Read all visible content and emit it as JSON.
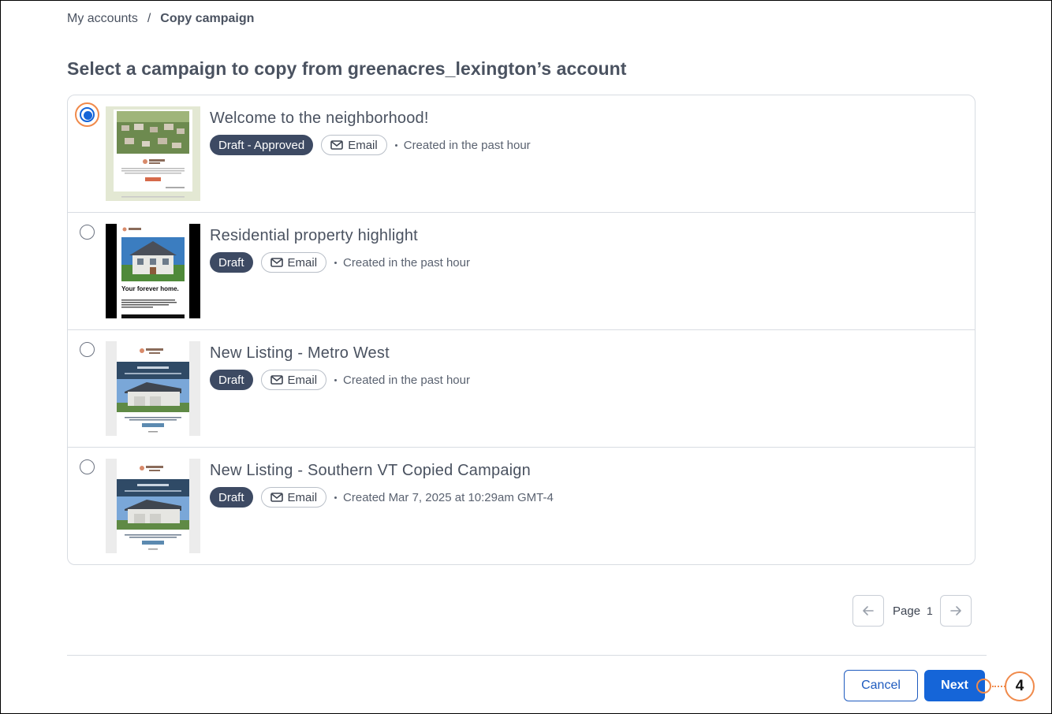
{
  "breadcrumb": {
    "root": "My accounts",
    "separator": "/",
    "current": "Copy campaign"
  },
  "page_title": "Select a campaign to copy from greenacres_lexington’s account",
  "campaigns": [
    {
      "title": "Welcome to the neighborhood!",
      "status": "Draft - Approved",
      "type": "Email",
      "created": "Created in the past hour",
      "selected": true
    },
    {
      "title": "Residential property highlight",
      "status": "Draft",
      "type": "Email",
      "created": "Created in the past hour",
      "selected": false
    },
    {
      "title": "New Listing - Metro West",
      "status": "Draft",
      "type": "Email",
      "created": "Created in the past hour",
      "selected": false
    },
    {
      "title": "New Listing - Southern VT Copied Campaign",
      "status": "Draft",
      "type": "Email",
      "created": "Created Mar 7, 2025 at 10:29am GMT-4",
      "selected": false
    }
  ],
  "thumbnails": {
    "residential_headline": "Your forever home."
  },
  "pagination": {
    "label": "Page",
    "current": "1"
  },
  "footer": {
    "cancel_label": "Cancel",
    "next_label": "Next"
  },
  "callout": {
    "step": "4"
  },
  "colors": {
    "accent": "#1565d8",
    "callout": "#f08a4b",
    "status_pill": "#3d4a63"
  },
  "icons": [
    "email-icon",
    "arrow-left-icon",
    "arrow-right-icon"
  ]
}
